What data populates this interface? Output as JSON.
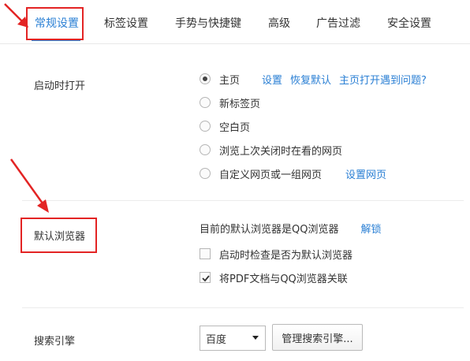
{
  "tabs": [
    {
      "label": "常规设置",
      "active": true
    },
    {
      "label": "标签设置",
      "active": false
    },
    {
      "label": "手势与快捷键",
      "active": false
    },
    {
      "label": "高级",
      "active": false
    },
    {
      "label": "广告过滤",
      "active": false
    },
    {
      "label": "安全设置",
      "active": false
    }
  ],
  "startup": {
    "label": "启动时打开",
    "options": [
      {
        "label": "主页",
        "checked": true
      },
      {
        "label": "新标签页",
        "checked": false
      },
      {
        "label": "空白页",
        "checked": false
      },
      {
        "label": "浏览上次关闭时在看的网页",
        "checked": false
      },
      {
        "label": "自定义网页或一组网页",
        "checked": false
      }
    ],
    "homepage_links": {
      "settings": "设置",
      "restore_default": "恢复默认",
      "problem": "主页打开遇到问题?"
    },
    "custom_link": "设置网页"
  },
  "default_browser": {
    "label": "默认浏览器",
    "status_text": "目前的默认浏览器是QQ浏览器",
    "unlock_link": "解锁",
    "check_on_startup": {
      "label": "启动时检查是否为默认浏览器",
      "checked": false
    },
    "pdf_association": {
      "label": "将PDF文档与QQ浏览器关联",
      "checked": true
    }
  },
  "search_engine": {
    "label": "搜索引擎",
    "selected": "百度",
    "manage_button": "管理搜索引擎..."
  },
  "colors": {
    "accent": "#2a7fd4",
    "annotation": "#e32424"
  }
}
